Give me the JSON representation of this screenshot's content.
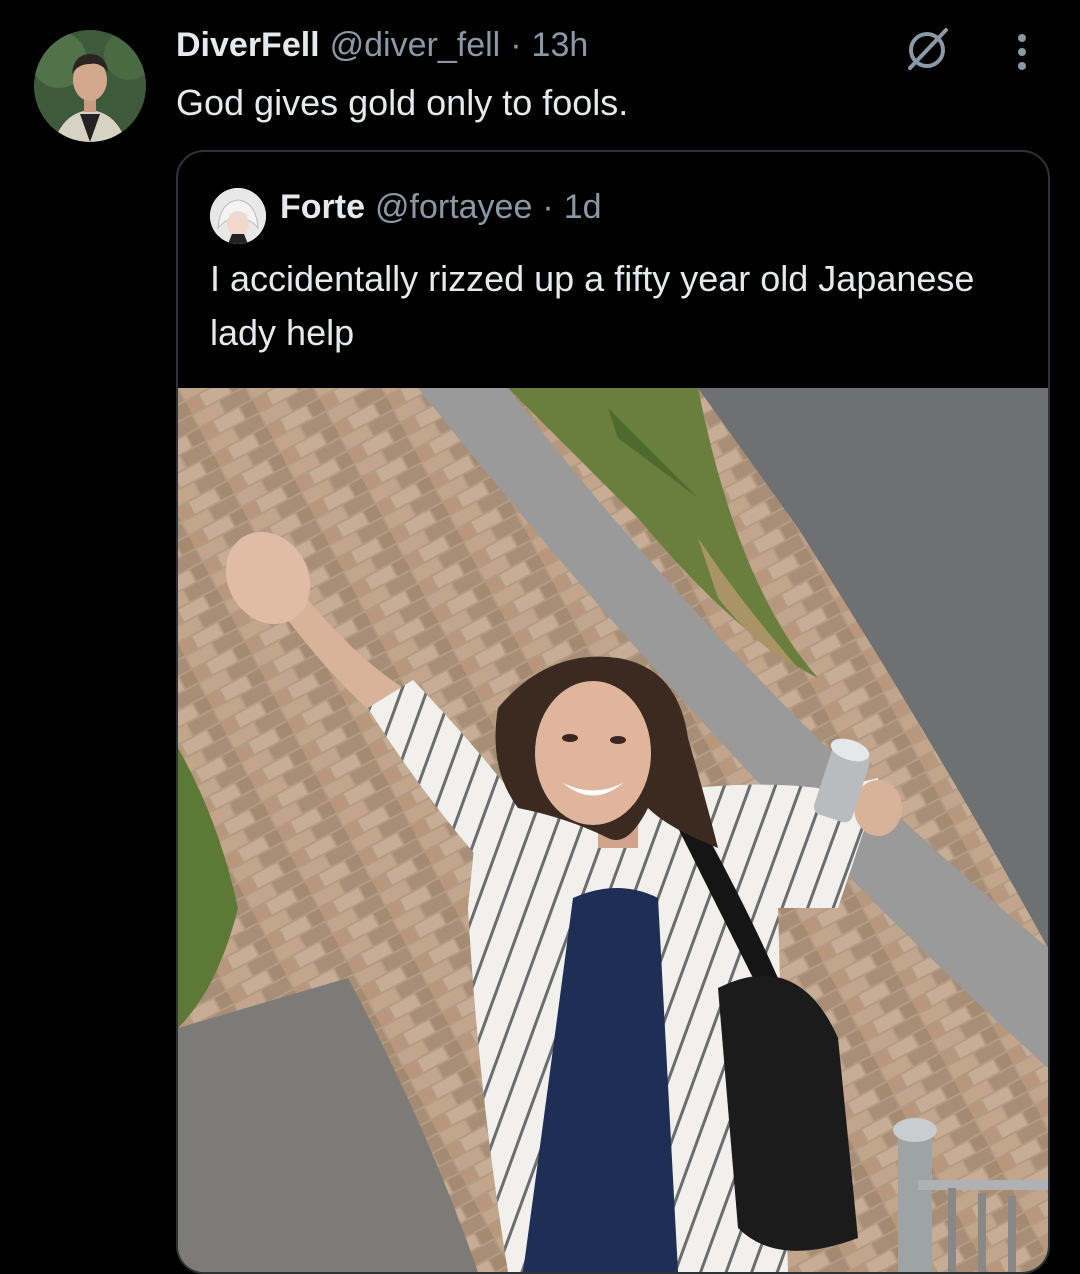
{
  "tweet": {
    "display_name": "DiverFell",
    "handle": "@diver_fell",
    "separator": "·",
    "time": "13h",
    "text": "God gives gold only to fools.",
    "avatar_icon": "user-avatar",
    "grok_icon": "grok-icon",
    "more_icon": "more-options-icon"
  },
  "quote": {
    "display_name": "Forte",
    "handle": "@fortayee",
    "separator": "·",
    "time": "1d",
    "text": "I accidentally rizzed up a fifty year old Japanese lady help",
    "avatar_icon": "user-avatar"
  },
  "colors": {
    "background": "#000000",
    "text_primary": "#e7e9ea",
    "text_secondary": "#8b98a5",
    "border": "#2f3336"
  }
}
